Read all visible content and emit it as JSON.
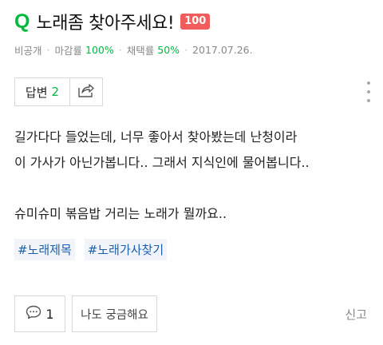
{
  "question": {
    "title": "노래좀 찾아주세요!",
    "points": "100"
  },
  "meta": {
    "visibility": "비공개",
    "deadline_label": "마감률",
    "deadline_value": "100%",
    "adoption_label": "채택률",
    "adoption_value": "50%",
    "date": "2017.07.26."
  },
  "answers": {
    "label": "답변",
    "count": "2"
  },
  "body": {
    "line1": "길가다다 들었는데, 너무 좋아서 찾아봤는데 난청이라",
    "line2": "이 가사가 아닌가봅니다.. 그래서 지식인에 물어봅니다..",
    "line3": "슈미슈미 볶음밥 거리는 노래가 뭘까요.."
  },
  "tags": [
    "#노래제목",
    "#노래가사찾기"
  ],
  "footer": {
    "comment_count": "1",
    "curious_label": "나도 궁금해요",
    "report_label": "신고"
  },
  "colors": {
    "accent_green": "#00b93f",
    "badge_red": "#f25c5c",
    "tag_blue": "#1c5fb0"
  }
}
